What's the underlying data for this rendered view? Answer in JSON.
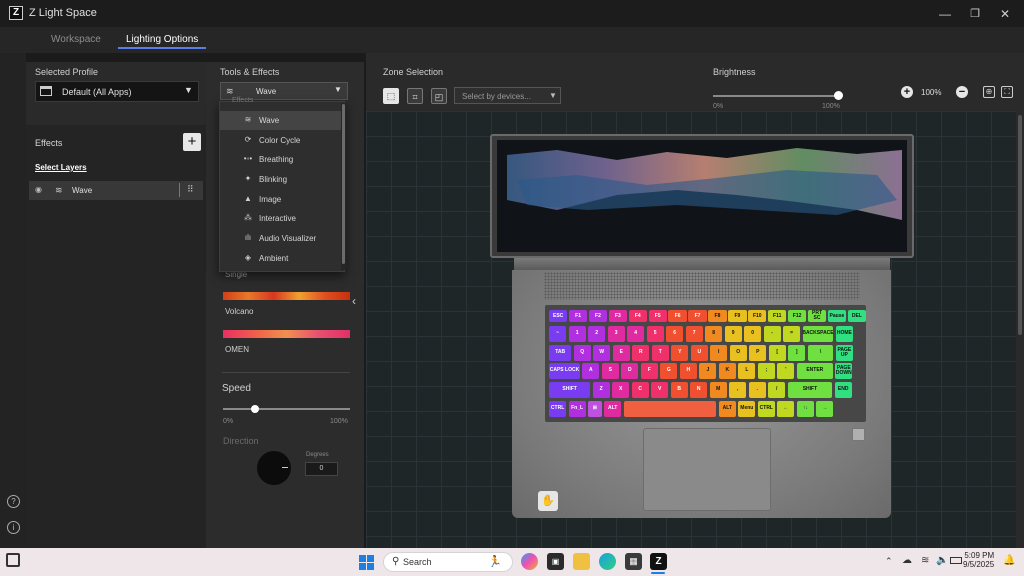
{
  "app": {
    "title": "Z Light Space",
    "logo_text": "Z"
  },
  "window_controls": {
    "minimize": "—",
    "maximize": "❐",
    "close": "✕"
  },
  "tabs": [
    {
      "label": "Workspace"
    },
    {
      "label": "Lighting Options"
    }
  ],
  "left_panel": {
    "selected_profile_label": "Selected Profile",
    "profile_value": "Default (All Apps)",
    "effects_label": "Effects",
    "add_label": "+",
    "select_layers_label": "Select Layers",
    "layer_name": "Wave"
  },
  "tools": {
    "title": "Tools & Effects",
    "effect_value": "Wave",
    "dropdown_items": [
      {
        "label": "Wave",
        "icon": "wave-icon",
        "glyph": "≋"
      },
      {
        "label": "Color Cycle",
        "icon": "color-cycle-icon",
        "glyph": "⟳"
      },
      {
        "label": "Breathing",
        "icon": "breathing-icon",
        "glyph": "•◦•"
      },
      {
        "label": "Blinking",
        "icon": "blinking-icon",
        "glyph": "✦"
      },
      {
        "label": "Image",
        "icon": "image-icon",
        "glyph": "▲"
      },
      {
        "label": "Interactive",
        "icon": "interactive-icon",
        "glyph": "⁂"
      },
      {
        "label": "Audio Visualizer",
        "icon": "audio-visualizer-icon",
        "glyph": "ılı"
      },
      {
        "label": "Ambient",
        "icon": "ambient-icon",
        "glyph": "◈"
      }
    ],
    "single_label": "Single",
    "volcano_label": "Volcano",
    "omen_label": "OMEN",
    "speed_label": "Speed",
    "speed_min": "0%",
    "speed_max": "100%",
    "speed_value": 0.25,
    "direction_label": "Direction",
    "degrees_label": "Degrees",
    "degrees_value": "0"
  },
  "zone": {
    "title": "Zone Selection",
    "device_placeholder": "Select by devices..."
  },
  "brightness": {
    "title": "Brightness",
    "min": "0%",
    "max": "100%",
    "value": 1.0,
    "zoom": "100%"
  },
  "keyboard": {
    "rows": [
      [
        "ESC",
        "F1",
        "F2",
        "F3",
        "F4",
        "F5",
        "F6",
        "F7",
        "F8",
        "F9",
        "F10",
        "F11",
        "F12",
        "PRT SC",
        "Pause",
        "DEL"
      ],
      [
        "~",
        "1",
        "2",
        "3",
        "4",
        "5",
        "6",
        "7",
        "8",
        "9",
        "0",
        "-",
        "=",
        "BACKSPACE",
        "HOME"
      ],
      [
        "TAB",
        "Q",
        "W",
        "E",
        "R",
        "T",
        "Y",
        "U",
        "I",
        "O",
        "P",
        "[",
        "]",
        "\\",
        "PAGE UP"
      ],
      [
        "CAPS LOCK",
        "A",
        "S",
        "D",
        "F",
        "G",
        "H",
        "J",
        "K",
        "L",
        ";",
        "'",
        "ENTER",
        "PAGE DOWN"
      ],
      [
        "SHIFT",
        "Z",
        "X",
        "C",
        "V",
        "B",
        "N",
        "M",
        ",",
        ".",
        "/",
        "SHIFT",
        "END"
      ],
      [
        "CTRL",
        "Fn_L",
        "⊞",
        "ALT",
        "",
        "ALT",
        "Menu",
        "CTRL",
        "←",
        "↑↓",
        "→"
      ]
    ]
  },
  "taskbar": {
    "search_placeholder": "Search",
    "time": "5:09 PM",
    "date": "9/5/2025"
  }
}
